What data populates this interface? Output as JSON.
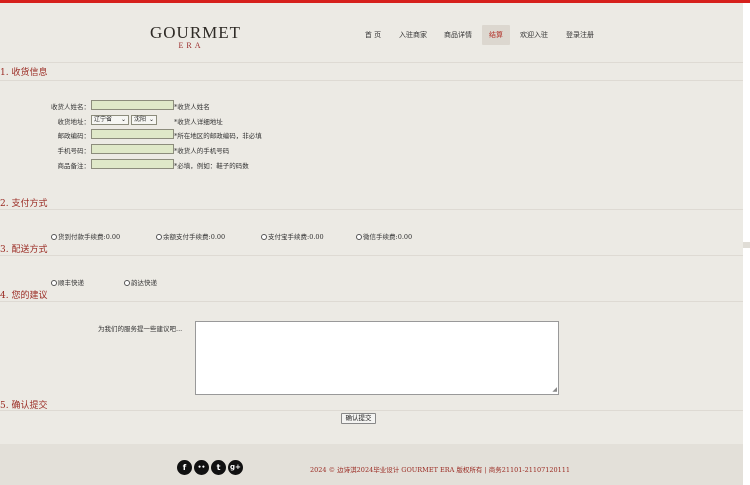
{
  "brand": {
    "logo_main": "GOURMET",
    "logo_sub": "ERA"
  },
  "nav": {
    "items": [
      {
        "label": "首 页",
        "active": false
      },
      {
        "label": "入驻商家",
        "active": false
      },
      {
        "label": "商品详情",
        "active": false
      },
      {
        "label": "结算",
        "active": true
      },
      {
        "label": "欢迎入驻",
        "active": false
      },
      {
        "label": "登录注册",
        "active": false
      }
    ]
  },
  "section1": {
    "title": "1. 收货信息",
    "fields": [
      {
        "label": "收货人姓名：",
        "value": "",
        "hint": "*收货人姓名"
      },
      {
        "label": "收货地址：",
        "province": "辽宁省",
        "city": "沈阳",
        "hint": "*收货人详细地址"
      },
      {
        "label": "邮政编码：",
        "value": "",
        "hint": "*所在地区的邮政编码，非必填"
      },
      {
        "label": "手机号码：",
        "value": "",
        "hint": "*收货人的手机号码"
      },
      {
        "label": "商品备注：",
        "value": "",
        "hint": "*必填，例如：鞋子的码数"
      }
    ]
  },
  "section2": {
    "title": "2. 支付方式",
    "options": [
      "货到付款手续费:0.00",
      "余额支付手续费:0.00",
      "支付宝手续费:0.00",
      "微信手续费:0.00"
    ]
  },
  "section3": {
    "title": "3. 配送方式",
    "options": [
      "顺丰快递",
      "韵达快递"
    ]
  },
  "section4": {
    "title": "4. 您的建议",
    "label": "为我们的服务提一些建议吧...",
    "value": ""
  },
  "section5": {
    "title": "5. 确认提交",
    "submit_label": "确认提交"
  },
  "footer": {
    "social": [
      {
        "icon": "facebook-icon",
        "glyph": "f"
      },
      {
        "icon": "flickr-icon",
        "glyph": "••"
      },
      {
        "icon": "twitter-icon",
        "glyph": "t"
      },
      {
        "icon": "google-plus-icon",
        "glyph": "g+"
      }
    ],
    "copyright": "2024 © 边诗淇2024毕业设计 GOURMET ERA 版权所有 | 商务21101-21107120111"
  },
  "colors": {
    "accent_red": "#d6201c",
    "title_red": "#9a2a22",
    "input_green": "#dfe8c8",
    "background": "#eceae4"
  }
}
